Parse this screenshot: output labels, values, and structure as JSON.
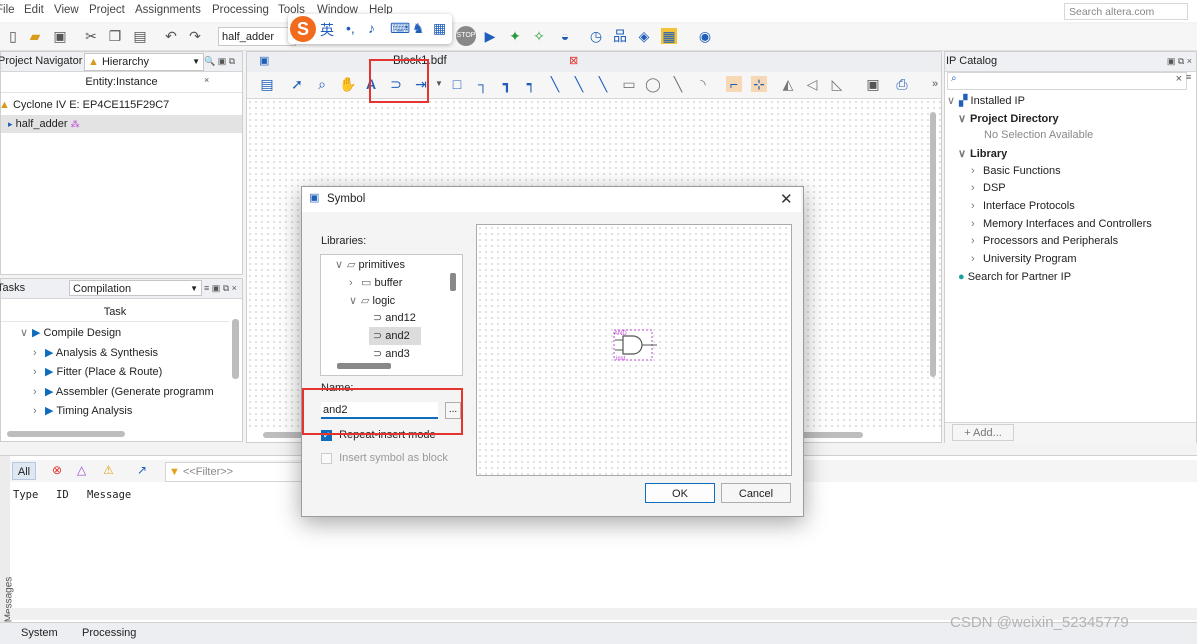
{
  "menubar": {
    "items": [
      "File",
      "Edit",
      "View",
      "Project",
      "Assignments",
      "Processing",
      "Tools",
      "Window",
      "Help"
    ],
    "search_placeholder": "Search altera.com"
  },
  "toolbar": {
    "project_combo": "half_adder"
  },
  "ime": {
    "logo": "S",
    "mode": "英",
    "punct": "•,",
    "mic_icon": "microphone-icon",
    "kbd_icon": "keyboard-icon",
    "skin_icon": "shirt-icon",
    "more_icon": "grid-icon"
  },
  "project_navigator": {
    "title": "Project Navigator",
    "view": "Hierarchy",
    "column": "Entity:Instance",
    "device": "Cyclone IV E: EP4CE115F29C7",
    "entity": "half_adder"
  },
  "tasks": {
    "title": "Tasks",
    "flow": "Compilation",
    "column": "Task",
    "items": [
      "Compile Design",
      "Analysis & Synthesis",
      "Fitter (Place & Route)",
      "Assembler (Generate programm",
      "Timing Analysis"
    ]
  },
  "document": {
    "tab_label": "Block1.bdf"
  },
  "ip_catalog": {
    "title": "IP Catalog",
    "installed": "Installed IP",
    "project_directory": "Project Directory",
    "no_selection": "No Selection Available",
    "library": "Library",
    "library_items": [
      "Basic Functions",
      "DSP",
      "Interface Protocols",
      "Memory Interfaces and Controllers",
      "Processors and Peripherals",
      "University Program"
    ],
    "partner": "Search for Partner IP",
    "add_label": "+ Add..."
  },
  "messages": {
    "all": "All",
    "filter_placeholder": "<<Filter>>",
    "col_type": "Type",
    "col_id": "ID",
    "col_message": "Message",
    "side_label": "Messages",
    "tabs": [
      "System",
      "Processing"
    ]
  },
  "symbol_dialog": {
    "title": "Symbol",
    "libraries_label": "Libraries:",
    "tree": [
      {
        "label": "primitives",
        "kind": "folder-open"
      },
      {
        "label": "buffer",
        "kind": "folder"
      },
      {
        "label": "logic",
        "kind": "folder-open"
      },
      {
        "label": "and12",
        "kind": "symbol"
      },
      {
        "label": "and2",
        "kind": "symbol"
      },
      {
        "label": "and3",
        "kind": "symbol"
      }
    ],
    "name_label": "Name:",
    "name_value": "and2",
    "browse_label": "...",
    "repeat_insert": "Repeat-insert mode",
    "insert_as_block": "Insert symbol as block",
    "preview_top": "AND",
    "preview_bottom": "inst",
    "ok": "OK",
    "cancel": "Cancel"
  },
  "watermark": "CSDN @weixin_52345779"
}
